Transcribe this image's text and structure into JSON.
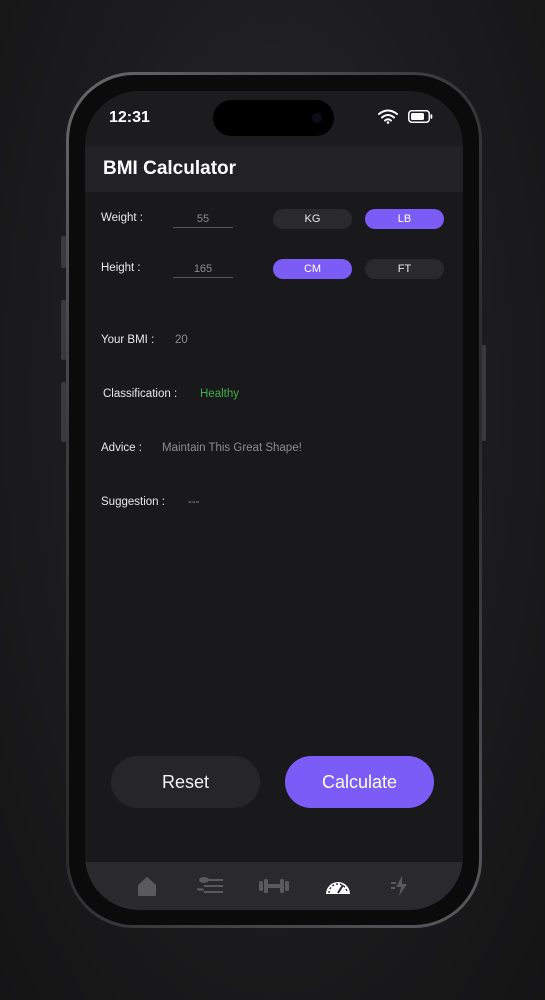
{
  "status_bar": {
    "time": "12:31"
  },
  "header": {
    "title": "BMI Calculator"
  },
  "form": {
    "weight": {
      "label": "Weight :",
      "value": "55",
      "units": [
        "KG",
        "LB"
      ],
      "active_unit": "LB"
    },
    "height": {
      "label": "Height :",
      "value": "165",
      "units": [
        "CM",
        "FT"
      ],
      "active_unit": "CM"
    }
  },
  "results": {
    "bmi": {
      "label": "Your BMI :",
      "value": "20"
    },
    "classification": {
      "label": "Classification :",
      "value": "Healthy"
    },
    "advice": {
      "label": "Advice :",
      "value": "Maintain This Great Shape!"
    },
    "suggestion": {
      "label": "Suggestion :",
      "value": "---"
    }
  },
  "actions": {
    "reset_label": "Reset",
    "calculate_label": "Calculate"
  },
  "tab_bar": {
    "items": [
      {
        "icon": "home-icon",
        "active": false
      },
      {
        "icon": "diet-icon",
        "active": false
      },
      {
        "icon": "dumbbell-icon",
        "active": false
      },
      {
        "icon": "speedometer-icon",
        "active": true
      },
      {
        "icon": "activity-icon",
        "active": false
      }
    ]
  },
  "colors": {
    "accent": "#7b5cf6",
    "healthy": "#3fae49",
    "background": "#19181b"
  }
}
